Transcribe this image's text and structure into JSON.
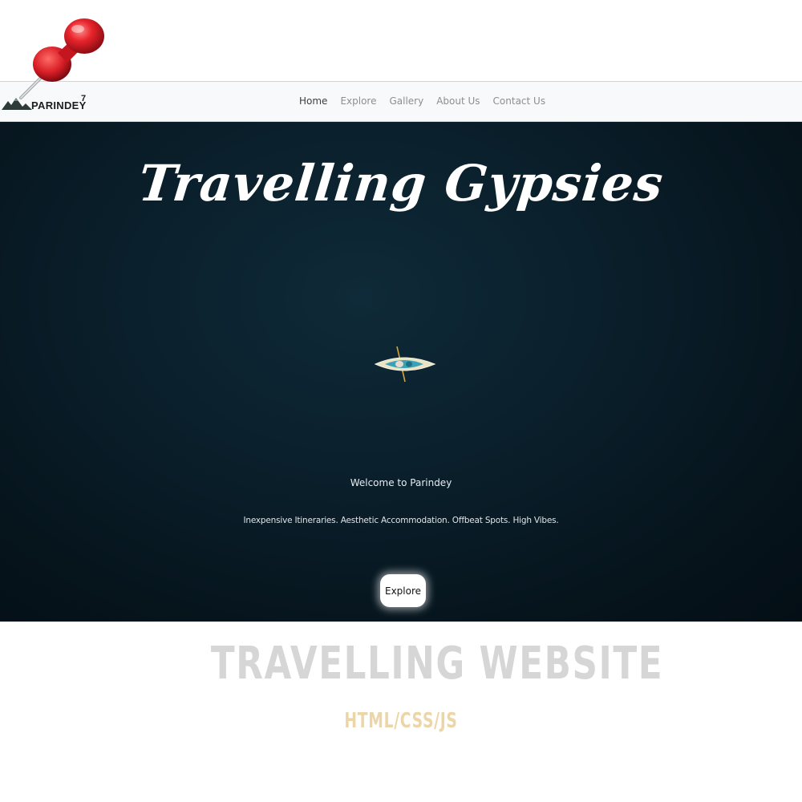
{
  "brand": {
    "name": "PARINDEY",
    "superscript": "7"
  },
  "nav": {
    "items": [
      {
        "label": "Home",
        "active": true
      },
      {
        "label": "Explore",
        "active": false
      },
      {
        "label": "Gallery",
        "active": false
      },
      {
        "label": "About Us",
        "active": false
      },
      {
        "label": "Contact Us",
        "active": false
      }
    ]
  },
  "hero": {
    "title": "Travelling Gypsies",
    "welcome": "Welcome to Parindey",
    "tagline": "Inexpensive Itineraries. Aesthetic Accommodation. Offbeat Spots. High Vibes.",
    "cta_label": "Explore",
    "background_color": "#0a1f2b"
  },
  "caption": {
    "title": "TRAVELLING WEBSITE",
    "subtitle": "HTML/CSS/JS"
  },
  "icons": {
    "pin": "pushpin-icon",
    "logo": "mountain-logo-icon",
    "kayak": "kayak-image"
  },
  "colors": {
    "pin_red": "#e8242c",
    "caption_gray": "#d6d6d6",
    "caption_gold": "#ecd6a8"
  }
}
